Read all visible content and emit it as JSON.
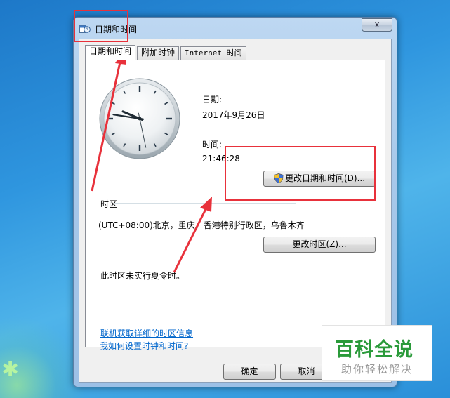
{
  "window": {
    "title": "日期和时间",
    "close_label": "x"
  },
  "tabs": [
    {
      "label": "日期和时间",
      "active": true
    },
    {
      "label": "附加时钟",
      "active": false
    },
    {
      "label": "Internet 时间",
      "active": false
    }
  ],
  "date_section": {
    "date_label": "日期:",
    "date_value": "2017年9月26日",
    "time_label": "时间:",
    "time_value": "21:46:28",
    "change_button": "更改日期和时间(D)..."
  },
  "timezone_section": {
    "group_label": "时区",
    "timezone_value": "(UTC+08:00)北京，重庆，香港特别行政区，乌鲁木齐",
    "change_button": "更改时区(Z)...",
    "dst_note": "此时区未实行夏令时。"
  },
  "links": {
    "online_info": "联机获取详细的时区信息",
    "how_to": "我如何设置时钟和时间?"
  },
  "footer": {
    "ok": "确定",
    "cancel": "取消"
  },
  "clock": {
    "hours": 21,
    "minutes": 46,
    "seconds": 28
  },
  "watermark": {
    "logo_text": "百科全说",
    "sub_text": "助你轻松解决"
  },
  "colors": {
    "annotation_red": "#e8313b",
    "link_blue": "#0066cc",
    "watermark_green": "#2a9a3a"
  }
}
